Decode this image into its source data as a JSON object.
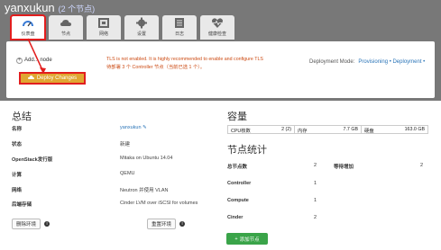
{
  "header": {
    "title": "yanxukun",
    "subtitle": "(2 个节点)"
  },
  "tabs": [
    {
      "label": "仪表盘",
      "icon": "dashboard-icon",
      "active": true
    },
    {
      "label": "节点",
      "icon": "cloud-icon"
    },
    {
      "label": "网络",
      "icon": "network-icon"
    },
    {
      "label": "设置",
      "icon": "gear-icon"
    },
    {
      "label": "日志",
      "icon": "logs-icon"
    },
    {
      "label": "健康检查",
      "icon": "heartbeat-icon"
    }
  ],
  "deploy_panel": {
    "add_node_label": "Add... node",
    "deploy_button_label": "Deploy Changes",
    "tls_message": "TLS is not enabled. It is highly recommended to enable and configure TLS",
    "tls_message_line2": "待部署 3 个 Controller 节点（当前已选 1 个）。",
    "deploy_mode_label": "Deployment Mode:",
    "deploy_mode_value": "Provisioning • Deployment •"
  },
  "summary": {
    "title": "总结",
    "rows": [
      {
        "key": "名称",
        "value": "yanxukun"
      },
      {
        "key": "状态",
        "value": "新建"
      },
      {
        "key": "OpenStack发行版",
        "value": "Mitaka on Ubuntu 14.04"
      },
      {
        "key": "计算",
        "value": "QEMU"
      },
      {
        "key": "网络",
        "value": "Neutron 并使用 VLAN"
      },
      {
        "key": "后端存储",
        "value": "Cinder LVM over iSCSI for volumes"
      }
    ],
    "delete_env_label": "删除环境",
    "reset_env_label": "重置环境"
  },
  "capacity": {
    "title": "容量",
    "cells": [
      {
        "key": "CPU核数",
        "value": "2 (2)"
      },
      {
        "key": "内存",
        "value": "7.7 GB"
      },
      {
        "key": "硬盘",
        "value": "163.0 GB"
      }
    ]
  },
  "node_stats": {
    "title": "节点统计",
    "total_label": "总节点数",
    "total_value": "2",
    "pending_label": "等待增加",
    "pending_value": "2",
    "roles": [
      {
        "key": "Controller",
        "value": "1"
      },
      {
        "key": "Compute",
        "value": "1"
      },
      {
        "key": "Cinder",
        "value": "2"
      }
    ],
    "add_nodes_label": "添加节点"
  },
  "colors": {
    "accent_red": "#e21e1e",
    "deploy_yellow": "#e0a631",
    "link_blue": "#2a74b8",
    "add_green": "#3aa449"
  }
}
